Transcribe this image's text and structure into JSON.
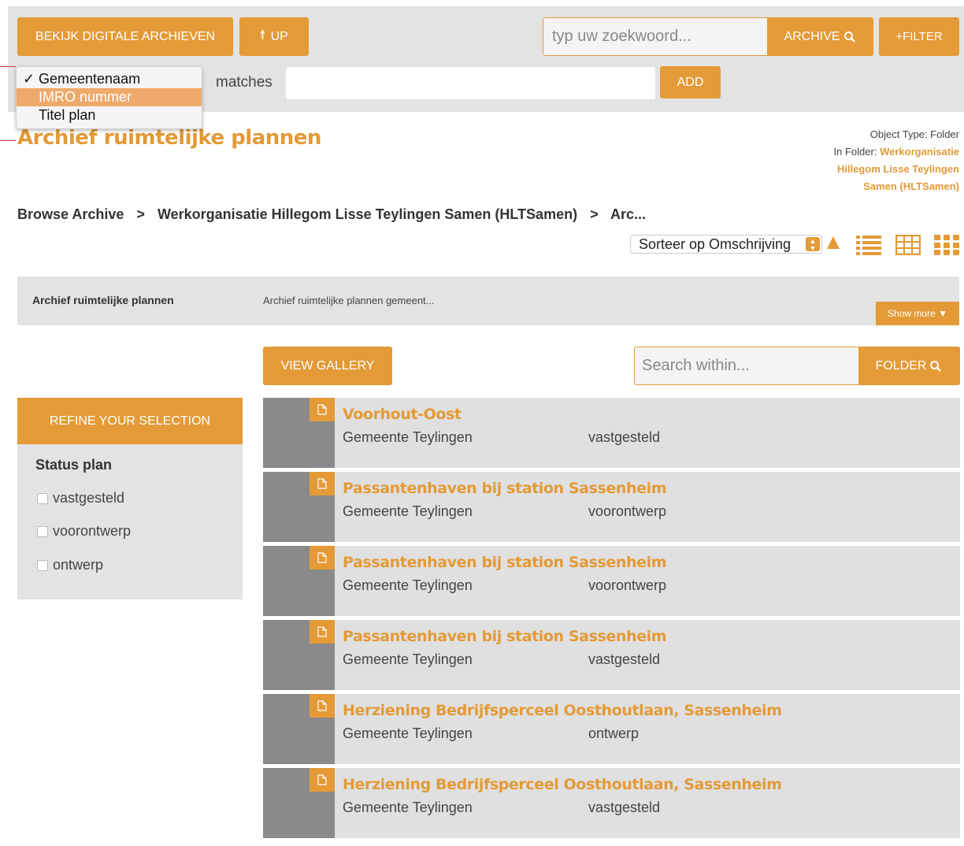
{
  "topbar": {
    "archives_button": "BEKIJK DIGITALE ARCHIEVEN",
    "up_button": "UP",
    "search_placeholder": "typ uw zoekwoord...",
    "archive_search_button": "ARCHIVE",
    "filter_button": "+FILTER",
    "matches_label": "matches",
    "add_button": "ADD"
  },
  "field_dropdown": {
    "options": [
      "Gemeentenaam",
      "IMRO nummer",
      "Titel plan"
    ],
    "checked": "Gemeentenaam",
    "highlighted": "IMRO nummer"
  },
  "page": {
    "title": "Archief ruimtelijke plannen",
    "object_type_label": "Object Type: Folder",
    "in_folder_label": "In Folder:",
    "in_folder_line1": "Werkorganisatie",
    "in_folder_line2": "Hillegom Lisse Teylingen",
    "in_folder_line3": "Samen (HLTSamen)"
  },
  "breadcrumb": {
    "items": [
      "Browse Archive",
      "Werkorganisatie Hillegom Lisse Teylingen Samen (HLTSamen)",
      "Arc..."
    ],
    "separator": ">"
  },
  "sort": {
    "selected": "Sorteer op Omschrijving"
  },
  "archive_info": {
    "name": "Archief ruimtelijke plannen",
    "description": "Archief ruimtelijke plannen gemeent...",
    "show_more": "Show more ▼"
  },
  "gallery_button": "VIEW GALLERY",
  "folder_search": {
    "placeholder": "Search within...",
    "button": "FOLDER"
  },
  "refine": {
    "header": "REFINE YOUR SELECTION",
    "facet_title": "Status plan",
    "options": [
      "vastgesteld",
      "voorontwerp",
      "ontwerp"
    ]
  },
  "results": [
    {
      "title": "Voorhout-Oost",
      "gemeente": "Gemeente Teylingen",
      "status": "vastgesteld"
    },
    {
      "title": "Passantenhaven bij station Sassenheim",
      "gemeente": "Gemeente Teylingen",
      "status": "voorontwerp"
    },
    {
      "title": "Passantenhaven bij station Sassenheim",
      "gemeente": "Gemeente Teylingen",
      "status": "voorontwerp"
    },
    {
      "title": "Passantenhaven bij station Sassenheim",
      "gemeente": "Gemeente Teylingen",
      "status": "vastgesteld"
    },
    {
      "title": "Herziening Bedrijfsperceel Oosthoutlaan, Sassenheim",
      "gemeente": "Gemeente Teylingen",
      "status": "ontwerp"
    },
    {
      "title": "Herziening Bedrijfsperceel Oosthoutlaan, Sassenheim",
      "gemeente": "Gemeente Teylingen",
      "status": "vastgesteld"
    }
  ],
  "colors": {
    "accent": "#e39a37",
    "panel_gray": "#e3e3e3",
    "thumb_gray": "#8a8a8a",
    "highlight": "#efa96a"
  }
}
